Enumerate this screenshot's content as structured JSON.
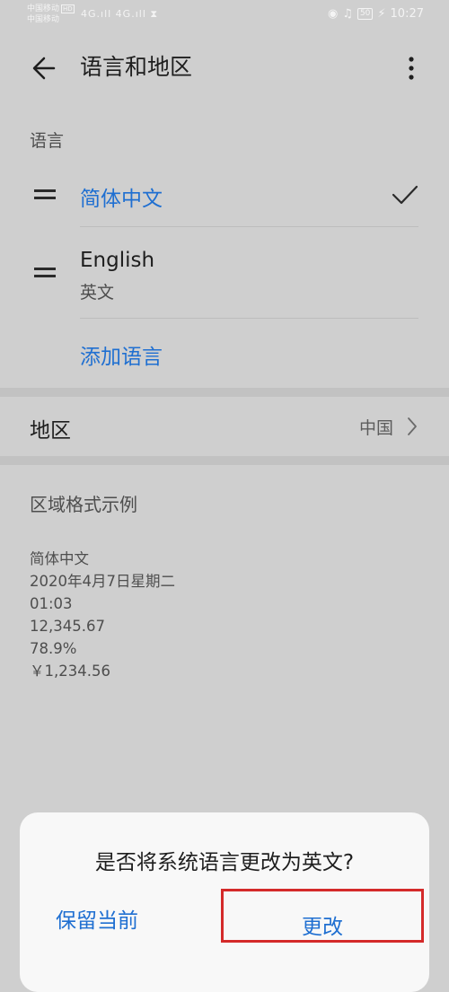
{
  "status_bar": {
    "carrier1": "中国移动",
    "carrier2": "中国移动",
    "hd_badge": "HD",
    "signal_text": "4G.ıll 4G.ıll",
    "battery": "50",
    "time": "10:27"
  },
  "header": {
    "title": "语言和地区"
  },
  "languages": {
    "section_label": "语言",
    "items": [
      {
        "name": "简体中文",
        "selected": true
      },
      {
        "name": "English",
        "subtitle": "英文"
      }
    ],
    "add_label": "添加语言"
  },
  "region": {
    "label": "地区",
    "value": "中国"
  },
  "format_example": {
    "title": "区域格式示例",
    "lines": [
      "简体中文",
      "2020年4月7日星期二",
      "01:03",
      "12,345.67",
      "78.9%",
      "￥1,234.56"
    ]
  },
  "dialog": {
    "message": "是否将系统语言更改为英文?",
    "keep_label": "保留当前",
    "change_label": "更改"
  }
}
